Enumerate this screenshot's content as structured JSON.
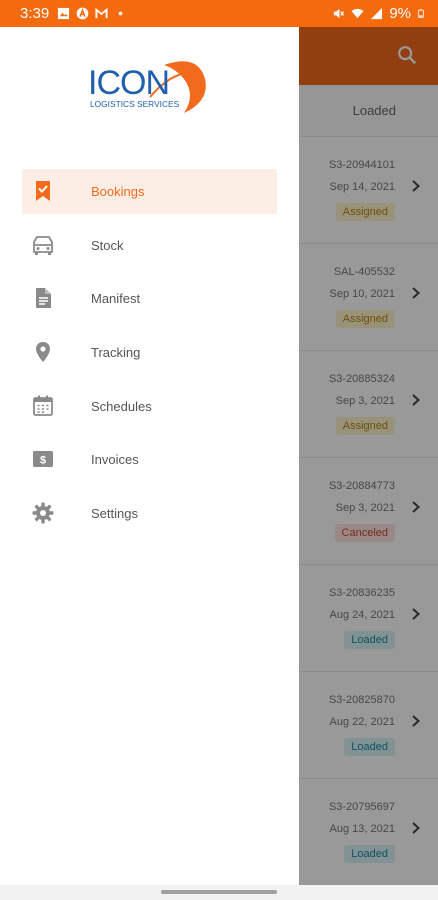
{
  "status_bar": {
    "time": "3:39",
    "battery": "9%",
    "left_icons": [
      "image-icon",
      "a-icon",
      "gmail-icon",
      "dot-icon"
    ],
    "right_icons": [
      "mute-icon",
      "wifi-icon",
      "signal-icon",
      "battery-icon"
    ]
  },
  "colors": {
    "accent": "#f26a1b",
    "status_bar": "#f46a0f",
    "active_bg": "#fdeee5",
    "icon_gray": "#8a8a8a"
  },
  "drawer": {
    "logo": {
      "text": "ICON",
      "subtitle": "LOGISTICS SERVICES"
    },
    "menu": [
      {
        "label": "Bookings",
        "icon": "bookmark-check-icon",
        "active": true
      },
      {
        "label": "Stock",
        "icon": "car-icon",
        "active": false
      },
      {
        "label": "Manifest",
        "icon": "document-icon",
        "active": false
      },
      {
        "label": "Tracking",
        "icon": "location-pin-icon",
        "active": false
      },
      {
        "label": "Schedules",
        "icon": "calendar-icon",
        "active": false
      },
      {
        "label": "Invoices",
        "icon": "dollar-bill-icon",
        "active": false
      },
      {
        "label": "Settings",
        "icon": "gear-icon",
        "active": false
      }
    ]
  },
  "background": {
    "column_header": "Loaded",
    "rows": [
      {
        "ref": "S3-20944101",
        "date": "Sep 14, 2021",
        "status": "Assigned",
        "kind": "assigned"
      },
      {
        "ref": "SAL-405532",
        "date": "Sep 10, 2021",
        "status": "Assigned",
        "kind": "assigned"
      },
      {
        "ref": "S3-20885324",
        "date": "Sep 3, 2021",
        "status": "Assigned",
        "kind": "assigned"
      },
      {
        "ref": "S3-20884773",
        "date": "Sep 3, 2021",
        "status": "Canceled",
        "kind": "canceled"
      },
      {
        "ref": "S3-20836235",
        "date": "Aug 24, 2021",
        "status": "Loaded",
        "kind": "loaded"
      },
      {
        "ref": "S3-20825870",
        "date": "Aug 22, 2021",
        "status": "Loaded",
        "kind": "loaded"
      },
      {
        "ref": "S3-20795697",
        "date": "Aug 13, 2021",
        "status": "Loaded",
        "kind": "loaded"
      }
    ]
  }
}
